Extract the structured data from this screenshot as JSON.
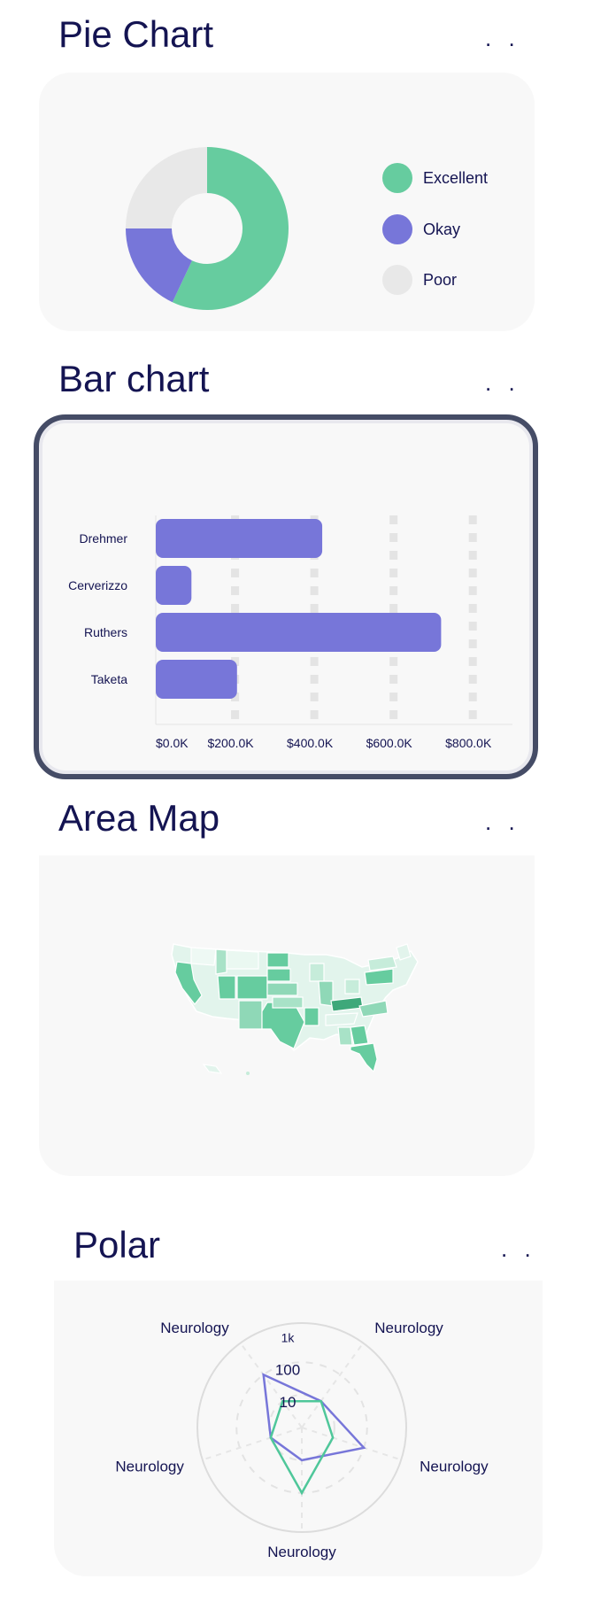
{
  "pie": {
    "title": "Pie Chart",
    "menu": ". .",
    "colors": {
      "Excellent": "#66cc9f",
      "Okay": "#7776d9",
      "Poor": "#e8e8e8"
    }
  },
  "bar": {
    "title": "Bar chart",
    "menu": ". .",
    "color": "#7776d9"
  },
  "map": {
    "title": "Area Map",
    "menu": ". .",
    "accent": "#66cc9f"
  },
  "polar": {
    "title": "Polar",
    "menu": ". ."
  },
  "chart_data": [
    {
      "type": "pie",
      "title": "Pie Chart",
      "donut": true,
      "labels": [
        "Excellent",
        "Okay",
        "Poor"
      ],
      "values": [
        57,
        18,
        25
      ],
      "legend_position": "right"
    },
    {
      "type": "bar",
      "title": "Bar chart",
      "orientation": "horizontal",
      "categories": [
        "Drehmer",
        "Cerverizzo",
        "Ruthers",
        "Taketa"
      ],
      "values": [
        420,
        90,
        720,
        205
      ],
      "xlim": [
        0,
        900
      ],
      "xticks": [
        "$0.0K",
        "$200.0K",
        "$400.0K",
        "$600.0K",
        "$800.0K"
      ],
      "tick_values": [
        0,
        200,
        400,
        600,
        800
      ],
      "grid": "vertical dashed"
    },
    {
      "type": "heatmap",
      "title": "Area Map",
      "subtype": "choropleth-usa",
      "color_scale": [
        "#e8f7f0",
        "#66cc9f",
        "#3ea87a"
      ]
    },
    {
      "type": "radar",
      "title": "Polar",
      "axes": [
        "Neurology",
        "Neurology",
        "Neurology",
        "Neurology",
        "Neurology"
      ],
      "scale": "log",
      "rlabels": [
        "10",
        "100",
        "1k"
      ],
      "rvalues": [
        10,
        100,
        1000
      ],
      "series": [
        {
          "color": "#7776d9",
          "values": [
            10,
            100,
            10,
            10,
            100
          ]
        },
        {
          "color": "#4fc79a",
          "values": [
            10,
            10,
            100,
            10,
            10
          ]
        }
      ]
    }
  ]
}
